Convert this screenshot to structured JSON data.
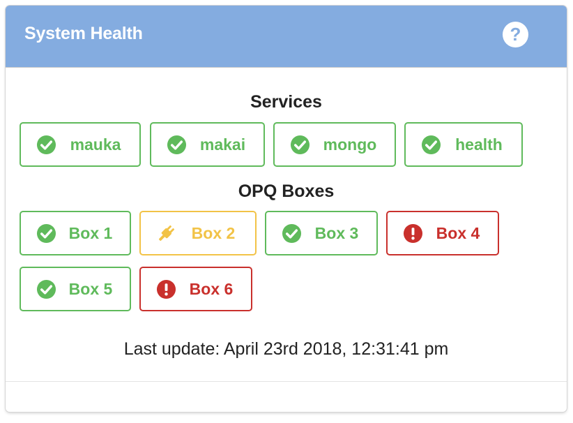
{
  "header": {
    "title": "System Health",
    "help_icon": "question-circle-icon"
  },
  "services": {
    "title": "Services",
    "items": [
      {
        "label": "mauka",
        "status": "ok"
      },
      {
        "label": "makai",
        "status": "ok"
      },
      {
        "label": "mongo",
        "status": "ok"
      },
      {
        "label": "health",
        "status": "ok"
      }
    ]
  },
  "boxes": {
    "title": "OPQ Boxes",
    "items": [
      {
        "label": "Box 1",
        "status": "ok"
      },
      {
        "label": "Box 2",
        "status": "unplugged"
      },
      {
        "label": "Box 3",
        "status": "ok"
      },
      {
        "label": "Box 4",
        "status": "error"
      },
      {
        "label": "Box 5",
        "status": "ok"
      },
      {
        "label": "Box 6",
        "status": "error"
      }
    ]
  },
  "footer": {
    "last_update": "Last update: April 23rd 2018, 12:31:41 pm"
  },
  "colors": {
    "header": "#84ace0",
    "ok": "#5fba5b",
    "warn": "#f2c347",
    "error": "#c9302c"
  }
}
